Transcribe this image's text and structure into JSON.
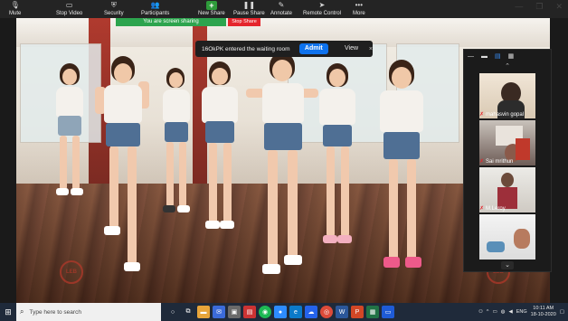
{
  "toolbar": {
    "items": [
      {
        "label": "Mute",
        "icon": "microphone-icon"
      },
      {
        "label": "Stop Video",
        "icon": "video-camera-icon"
      },
      {
        "label": "Security",
        "icon": "shield-icon"
      },
      {
        "label": "Participants",
        "icon": "participants-icon",
        "count": "5"
      },
      {
        "label": "New Share",
        "icon": "plus-icon"
      },
      {
        "label": "Pause Share",
        "icon": "pause-icon"
      },
      {
        "label": "Annotate",
        "icon": "pencil-icon"
      },
      {
        "label": "Remote Control",
        "icon": "mouse-pointer-icon"
      },
      {
        "label": "More",
        "icon": "ellipsis-icon"
      }
    ],
    "share_banner": "You are screen sharing",
    "stop_share": "Stop Share"
  },
  "notification": {
    "message": "16OkPK entered the waiting room",
    "admit_label": "Admit",
    "view_label": "View",
    "close": "×"
  },
  "participants_panel": {
    "thumbs": [
      {
        "name": "mahasvin gopal"
      },
      {
        "name": "Sai mrithun"
      },
      {
        "name": "M.Leroy"
      },
      {
        "name": ""
      }
    ]
  },
  "taskbar": {
    "search_placeholder": "Type here to search",
    "language": "ENG",
    "time": "10:11 AM",
    "date": "18-10-2020"
  },
  "colors": {
    "accent_blue": "#0e72ed",
    "share_green": "#2da44e",
    "stop_red": "#e5252c",
    "toolbar_bg": "#242424"
  }
}
